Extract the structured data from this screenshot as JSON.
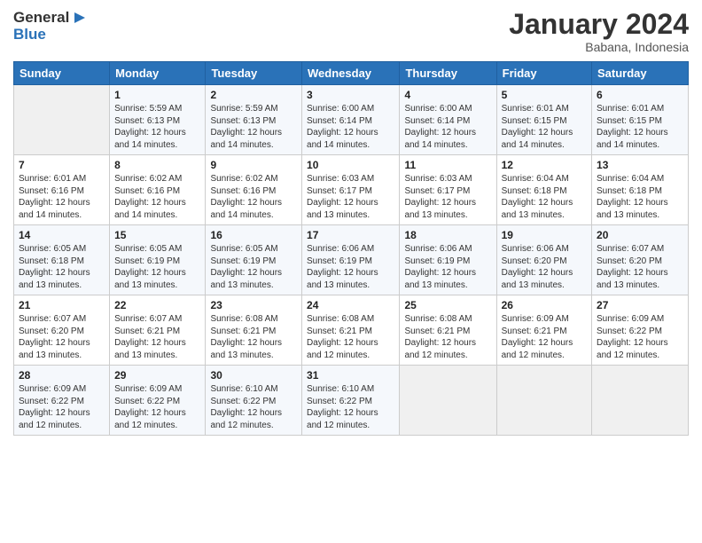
{
  "header": {
    "logo_line1": "General",
    "logo_line2": "Blue",
    "month_title": "January 2024",
    "subtitle": "Babana, Indonesia"
  },
  "weekdays": [
    "Sunday",
    "Monday",
    "Tuesday",
    "Wednesday",
    "Thursday",
    "Friday",
    "Saturday"
  ],
  "weeks": [
    [
      {
        "day": "",
        "sunrise": "",
        "sunset": "",
        "daylight": ""
      },
      {
        "day": "1",
        "sunrise": "Sunrise: 5:59 AM",
        "sunset": "Sunset: 6:13 PM",
        "daylight": "Daylight: 12 hours and 14 minutes."
      },
      {
        "day": "2",
        "sunrise": "Sunrise: 5:59 AM",
        "sunset": "Sunset: 6:13 PM",
        "daylight": "Daylight: 12 hours and 14 minutes."
      },
      {
        "day": "3",
        "sunrise": "Sunrise: 6:00 AM",
        "sunset": "Sunset: 6:14 PM",
        "daylight": "Daylight: 12 hours and 14 minutes."
      },
      {
        "day": "4",
        "sunrise": "Sunrise: 6:00 AM",
        "sunset": "Sunset: 6:14 PM",
        "daylight": "Daylight: 12 hours and 14 minutes."
      },
      {
        "day": "5",
        "sunrise": "Sunrise: 6:01 AM",
        "sunset": "Sunset: 6:15 PM",
        "daylight": "Daylight: 12 hours and 14 minutes."
      },
      {
        "day": "6",
        "sunrise": "Sunrise: 6:01 AM",
        "sunset": "Sunset: 6:15 PM",
        "daylight": "Daylight: 12 hours and 14 minutes."
      }
    ],
    [
      {
        "day": "7",
        "sunrise": "",
        "sunset": "",
        "daylight": ""
      },
      {
        "day": "8",
        "sunrise": "Sunrise: 6:02 AM",
        "sunset": "Sunset: 6:16 PM",
        "daylight": "Daylight: 12 hours and 14 minutes."
      },
      {
        "day": "9",
        "sunrise": "Sunrise: 6:02 AM",
        "sunset": "Sunset: 6:16 PM",
        "daylight": "Daylight: 12 hours and 14 minutes."
      },
      {
        "day": "10",
        "sunrise": "Sunrise: 6:03 AM",
        "sunset": "Sunset: 6:17 PM",
        "daylight": "Daylight: 12 hours and 13 minutes."
      },
      {
        "day": "11",
        "sunrise": "Sunrise: 6:03 AM",
        "sunset": "Sunset: 6:17 PM",
        "daylight": "Daylight: 12 hours and 13 minutes."
      },
      {
        "day": "12",
        "sunrise": "Sunrise: 6:04 AM",
        "sunset": "Sunset: 6:18 PM",
        "daylight": "Daylight: 12 hours and 13 minutes."
      },
      {
        "day": "13",
        "sunrise": "Sunrise: 6:04 AM",
        "sunset": "Sunset: 6:18 PM",
        "daylight": "Daylight: 12 hours and 13 minutes."
      }
    ],
    [
      {
        "day": "14",
        "sunrise": "",
        "sunset": "",
        "daylight": ""
      },
      {
        "day": "15",
        "sunrise": "Sunrise: 6:05 AM",
        "sunset": "Sunset: 6:19 PM",
        "daylight": "Daylight: 12 hours and 13 minutes."
      },
      {
        "day": "16",
        "sunrise": "Sunrise: 6:05 AM",
        "sunset": "Sunset: 6:19 PM",
        "daylight": "Daylight: 12 hours and 13 minutes."
      },
      {
        "day": "17",
        "sunrise": "Sunrise: 6:06 AM",
        "sunset": "Sunset: 6:19 PM",
        "daylight": "Daylight: 12 hours and 13 minutes."
      },
      {
        "day": "18",
        "sunrise": "Sunrise: 6:06 AM",
        "sunset": "Sunset: 6:19 PM",
        "daylight": "Daylight: 12 hours and 13 minutes."
      },
      {
        "day": "19",
        "sunrise": "Sunrise: 6:06 AM",
        "sunset": "Sunset: 6:20 PM",
        "daylight": "Daylight: 12 hours and 13 minutes."
      },
      {
        "day": "20",
        "sunrise": "Sunrise: 6:07 AM",
        "sunset": "Sunset: 6:20 PM",
        "daylight": "Daylight: 12 hours and 13 minutes."
      }
    ],
    [
      {
        "day": "21",
        "sunrise": "",
        "sunset": "",
        "daylight": ""
      },
      {
        "day": "22",
        "sunrise": "Sunrise: 6:07 AM",
        "sunset": "Sunset: 6:21 PM",
        "daylight": "Daylight: 12 hours and 13 minutes."
      },
      {
        "day": "23",
        "sunrise": "Sunrise: 6:08 AM",
        "sunset": "Sunset: 6:21 PM",
        "daylight": "Daylight: 12 hours and 13 minutes."
      },
      {
        "day": "24",
        "sunrise": "Sunrise: 6:08 AM",
        "sunset": "Sunset: 6:21 PM",
        "daylight": "Daylight: 12 hours and 12 minutes."
      },
      {
        "day": "25",
        "sunrise": "Sunrise: 6:08 AM",
        "sunset": "Sunset: 6:21 PM",
        "daylight": "Daylight: 12 hours and 12 minutes."
      },
      {
        "day": "26",
        "sunrise": "Sunrise: 6:09 AM",
        "sunset": "Sunset: 6:21 PM",
        "daylight": "Daylight: 12 hours and 12 minutes."
      },
      {
        "day": "27",
        "sunrise": "Sunrise: 6:09 AM",
        "sunset": "Sunset: 6:22 PM",
        "daylight": "Daylight: 12 hours and 12 minutes."
      }
    ],
    [
      {
        "day": "28",
        "sunrise": "",
        "sunset": "",
        "daylight": ""
      },
      {
        "day": "29",
        "sunrise": "Sunrise: 6:09 AM",
        "sunset": "Sunset: 6:22 PM",
        "daylight": "Daylight: 12 hours and 12 minutes."
      },
      {
        "day": "30",
        "sunrise": "Sunrise: 6:10 AM",
        "sunset": "Sunset: 6:22 PM",
        "daylight": "Daylight: 12 hours and 12 minutes."
      },
      {
        "day": "31",
        "sunrise": "Sunrise: 6:10 AM",
        "sunset": "Sunset: 6:22 PM",
        "daylight": "Daylight: 12 hours and 12 minutes."
      },
      {
        "day": "",
        "sunrise": "",
        "sunset": "",
        "daylight": ""
      },
      {
        "day": "",
        "sunrise": "",
        "sunset": "",
        "daylight": ""
      },
      {
        "day": "",
        "sunrise": "",
        "sunset": "",
        "daylight": ""
      }
    ]
  ],
  "week1_sunday": {
    "day": "7",
    "sunrise": "Sunrise: 6:01 AM",
    "sunset": "Sunset: 6:16 PM",
    "daylight": "Daylight: 12 hours and 14 minutes."
  },
  "week2_sunday": {
    "day": "14",
    "sunrise": "Sunrise: 6:05 AM",
    "sunset": "Sunset: 6:18 PM",
    "daylight": "Daylight: 12 hours and 13 minutes."
  },
  "week3_sunday": {
    "day": "21",
    "sunrise": "Sunrise: 6:07 AM",
    "sunset": "Sunset: 6:20 PM",
    "daylight": "Daylight: 12 hours and 13 minutes."
  },
  "week4_sunday": {
    "day": "28",
    "sunrise": "Sunrise: 6:09 AM",
    "sunset": "Sunset: 6:22 PM",
    "daylight": "Daylight: 12 hours and 12 minutes."
  }
}
